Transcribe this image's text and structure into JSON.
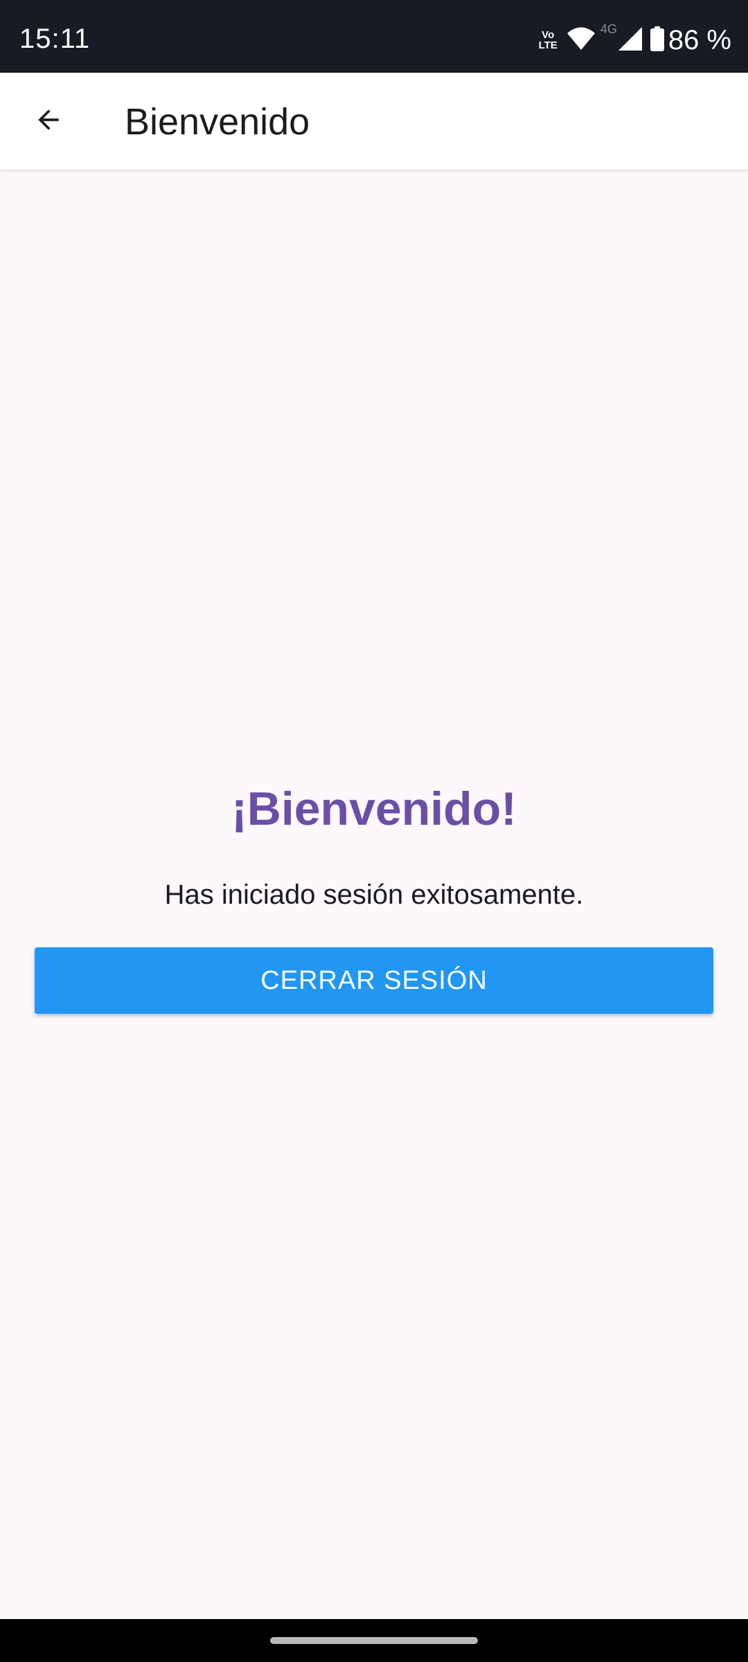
{
  "status_bar": {
    "time": "15:11",
    "volte_top": "Vo",
    "volte_bottom": "LTE",
    "network_type": "4G",
    "battery": "86 %",
    "icons": [
      "volte-icon",
      "wifi-icon",
      "cell-signal-icon",
      "battery-icon"
    ]
  },
  "app_bar": {
    "back_icon": "arrow-back-icon",
    "title": "Bienvenido"
  },
  "main": {
    "heading": "¡Bienvenido!",
    "message": "Has iniciado sesión exitosamente.",
    "logout_label": "CERRAR SESIÓN"
  },
  "colors": {
    "status_bar_bg": "#181b23",
    "background": "#fdf8fc",
    "heading": "#6a4fa6",
    "button": "#2196f3"
  }
}
